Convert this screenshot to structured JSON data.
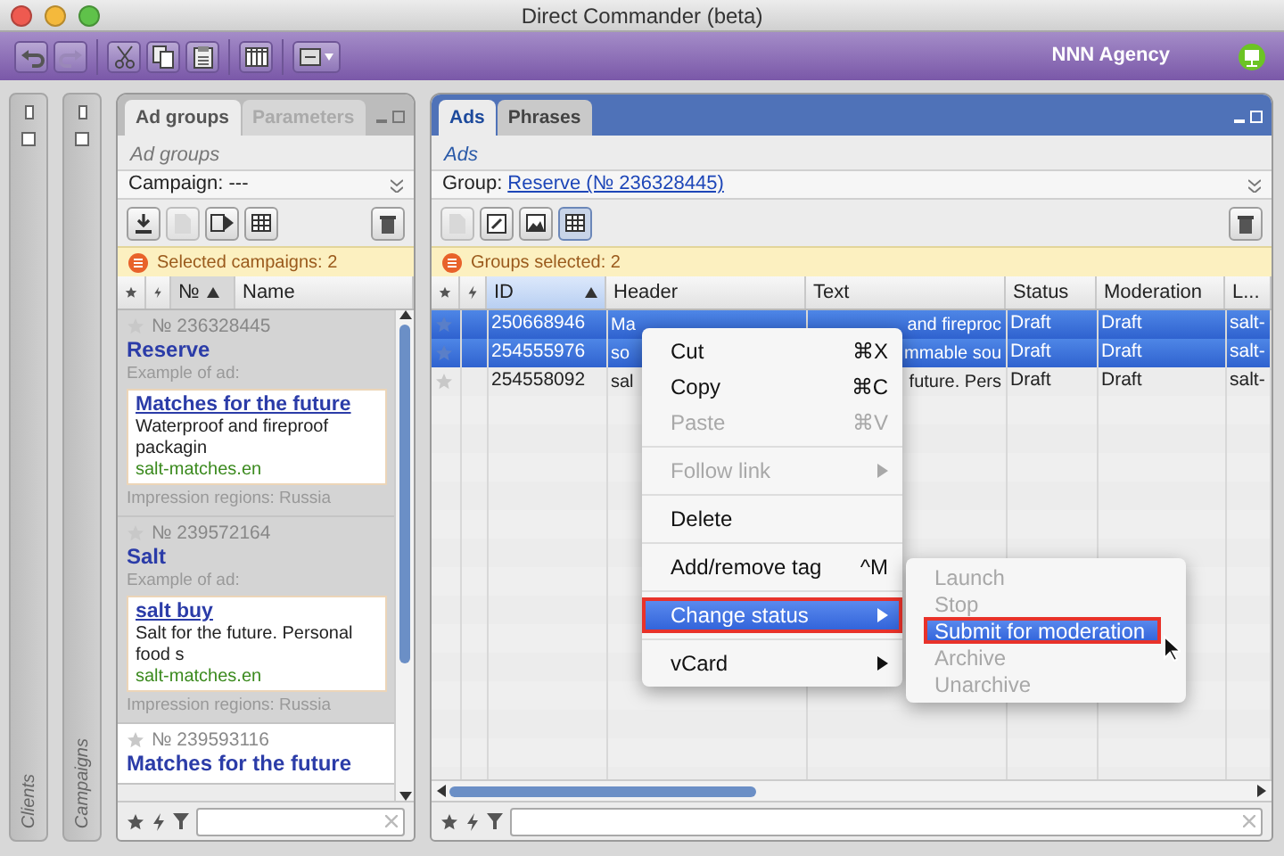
{
  "window": {
    "title": "Direct Commander (beta)"
  },
  "toolbar": {
    "account": "NNN Agency"
  },
  "side_tabs": [
    {
      "label": "Clients"
    },
    {
      "label": "Campaigns"
    }
  ],
  "left_panel": {
    "tabs": [
      {
        "label": "Ad groups",
        "selected": true
      },
      {
        "label": "Parameters",
        "selected": false
      }
    ],
    "subtitle": "Ad groups",
    "campaign": "Campaign: ---",
    "notice": "Selected campaigns: 2",
    "columns": [
      "№",
      "Name"
    ],
    "groups": [
      {
        "number": "№ 236328445",
        "name": "Reserve",
        "example_label": "Example of ad:",
        "ad": {
          "title": "Matches for the future",
          "text": "Waterproof and fireproof packagin",
          "url": "salt-matches.en"
        },
        "regions": "Impression regions: Russia",
        "selected": true
      },
      {
        "number": "№ 239572164",
        "name": "Salt",
        "example_label": "Example of ad:",
        "ad": {
          "title": "salt buy",
          "text": "Salt for the future. Personal food s",
          "url": "salt-matches.en"
        },
        "regions": "Impression regions: Russia",
        "selected": true
      },
      {
        "number": "№ 239593116",
        "name": "Matches for the future",
        "selected": false
      }
    ]
  },
  "right_panel": {
    "tabs": [
      {
        "label": "Ads",
        "selected": true
      },
      {
        "label": "Phrases",
        "selected": false
      }
    ],
    "subtitle": "Ads",
    "group_label": "Group:",
    "group_link": "Reserve (№ 236328445)",
    "notice": "Groups selected: 2",
    "columns": [
      "ID",
      "Header",
      "Text",
      "Status",
      "Moderation",
      "L..."
    ],
    "rows": [
      {
        "cells": [
          "250668946",
          "Ma",
          "and fireproc",
          "Draft",
          "Draft",
          "salt-"
        ],
        "selected": true
      },
      {
        "cells": [
          "254555976",
          "so",
          "mmable sou",
          "Draft",
          "Draft",
          "salt-"
        ],
        "selected": true
      },
      {
        "cells": [
          "254558092",
          "sal",
          "future. Pers",
          "Draft",
          "Draft",
          "salt-"
        ],
        "selected": false
      }
    ]
  },
  "context_menu": {
    "items": [
      {
        "kind": "item",
        "label": "Cut",
        "shortcut": "⌘X",
        "disabled": false
      },
      {
        "kind": "item",
        "label": "Copy",
        "shortcut": "⌘C",
        "disabled": false
      },
      {
        "kind": "item",
        "label": "Paste",
        "shortcut": "⌘V",
        "disabled": true
      },
      {
        "kind": "separator"
      },
      {
        "kind": "submenu",
        "label": "Follow link",
        "disabled": true
      },
      {
        "kind": "separator"
      },
      {
        "kind": "item",
        "label": "Delete",
        "disabled": false
      },
      {
        "kind": "separator"
      },
      {
        "kind": "item",
        "label": "Add/remove tag",
        "shortcut": "^M",
        "disabled": false
      },
      {
        "kind": "separator"
      },
      {
        "kind": "submenu",
        "label": "Change status",
        "disabled": false,
        "selected": true,
        "outlined": true
      },
      {
        "kind": "separator"
      },
      {
        "kind": "submenu",
        "label": "vCard",
        "disabled": false
      }
    ]
  },
  "status_submenu": {
    "items": [
      {
        "label": "Launch",
        "disabled": true,
        "selected": false
      },
      {
        "label": "Stop",
        "disabled": true,
        "selected": false
      },
      {
        "label": "Submit for moderation",
        "disabled": false,
        "selected": true,
        "outlined": true
      },
      {
        "label": "Archive",
        "disabled": true,
        "selected": false
      },
      {
        "label": "Unarchive",
        "disabled": true,
        "selected": false
      }
    ]
  }
}
